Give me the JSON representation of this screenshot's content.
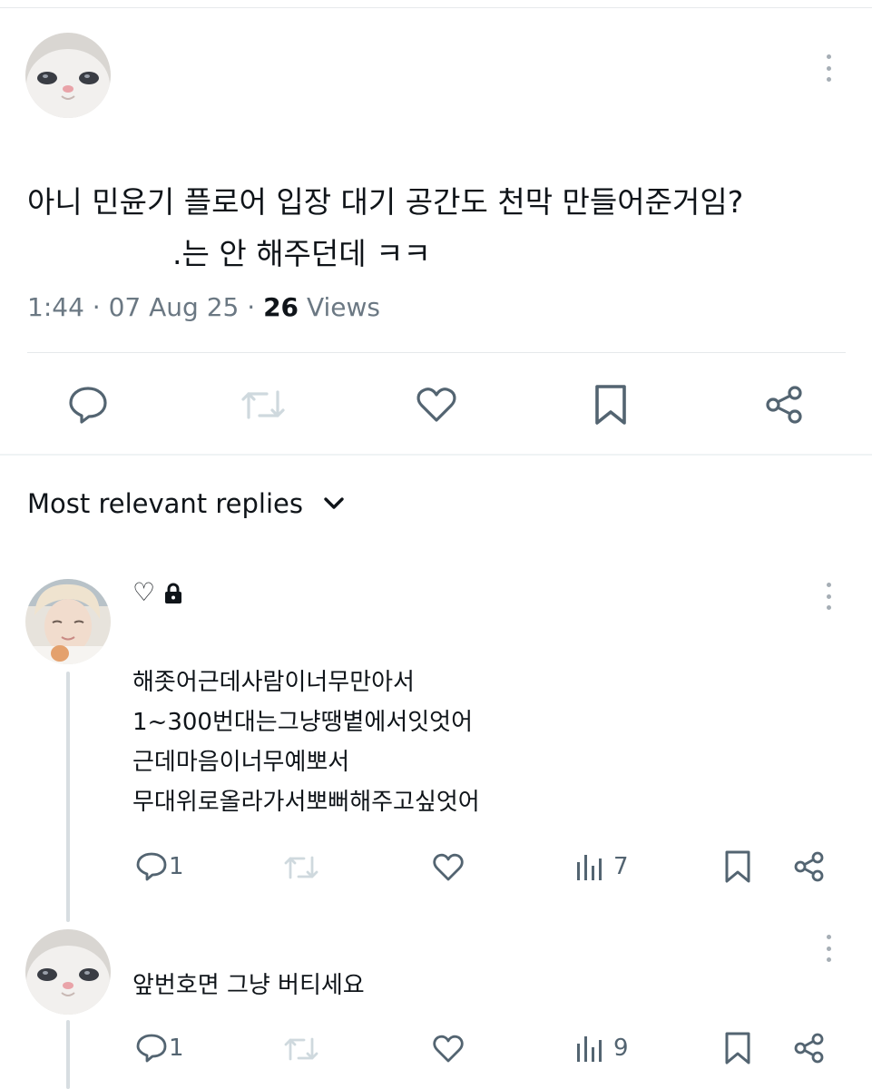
{
  "post": {
    "text_line1": "아니 민윤기 플로어 입장 대기 공간도 천막 만들어준거임?",
    "text_line2": ".는 안 해주던데 ㅋㅋ",
    "time": "1:44",
    "date": "07 Aug 25",
    "views_count": "26",
    "views_label": "Views",
    "sep": "·"
  },
  "replies_header": {
    "label": "Most relevant replies"
  },
  "replies": [
    {
      "name_glyph": "♡",
      "lines": [
        "해좃어근데사람이너무만아서",
        "1~300번대는그냥땡볕에서잇엇어",
        "근데마음이너무예뽀서",
        "무대위로올라가서뽀뻐해주고싶엇어"
      ],
      "reply_count": "1",
      "view_count": "7"
    },
    {
      "text": "앞번호면 그냥 버티세요",
      "reply_count": "1",
      "view_count": "9"
    }
  ],
  "colors": {
    "icon": "#536471",
    "icon_light": "#cfd9de",
    "divider": "#e6e9eb",
    "meta": "#6b7883"
  }
}
